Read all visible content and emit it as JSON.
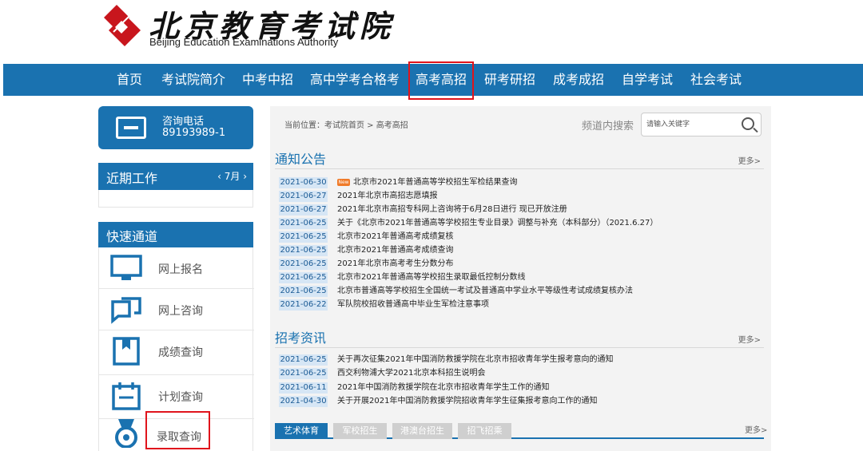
{
  "header": {
    "title_cn": "北京教育考试院",
    "title_en": "Beijing Education Examinations Authority"
  },
  "nav": {
    "items": [
      "首页",
      "考试院简介",
      "中考中招",
      "高中学考合格考",
      "高考高招",
      "研考研招",
      "成考成招",
      "自学考试",
      "社会考试"
    ],
    "active": "高考高招"
  },
  "sidebar": {
    "consult_label": "咨询电话",
    "consult_phone": "89193989-1",
    "recent_title": "近期工作",
    "recent_month": "‹ 7月 ›",
    "quick_title": "快速通道",
    "quick_items": [
      {
        "label": "网上报名",
        "icon": "monitor-icon"
      },
      {
        "label": "网上咨询",
        "icon": "chat-icon"
      },
      {
        "label": "成绩查询",
        "icon": "bookmark-icon"
      },
      {
        "label": "计划查询",
        "icon": "calendar-icon"
      },
      {
        "label": "录取查询",
        "icon": "medal-icon"
      }
    ]
  },
  "main": {
    "breadcrumb": "当前位置：考试院首页 > 高考高招",
    "search_label": "频道内搜索",
    "search_placeholder": "请输入关键字",
    "notice": {
      "title": "通知公告",
      "more": "更多>",
      "items": [
        {
          "date": "2021-06-30",
          "text": "北京市2021年普通高等学校招生军检结果查询",
          "new": true,
          "badge": "New"
        },
        {
          "date": "2021-06-27",
          "text": "2021年北京市高招志愿填报"
        },
        {
          "date": "2021-06-27",
          "text": "2021年北京市高招专科网上咨询将于6月28日进行 现已开放注册"
        },
        {
          "date": "2021-06-25",
          "text": "关于《北京市2021年普通高等学校招生专业目录》调整与补充（本科部分）（2021.6.27）"
        },
        {
          "date": "2021-06-25",
          "text": "北京市2021年普通高考成绩复核"
        },
        {
          "date": "2021-06-25",
          "text": "北京市2021年普通高考成绩查询"
        },
        {
          "date": "2021-06-25",
          "text": "2021年北京市高考考生分数分布"
        },
        {
          "date": "2021-06-25",
          "text": "北京市2021年普通高等学校招生录取最低控制分数线"
        },
        {
          "date": "2021-06-25",
          "text": "北京市普通高等学校招生全国统一考试及普通高中学业水平等级性考试成绩复核办法"
        },
        {
          "date": "2021-06-22",
          "text": "军队院校招收普通高中毕业生军检注意事项"
        }
      ]
    },
    "exam_news": {
      "title": "招考资讯",
      "more": "更多>",
      "items": [
        {
          "date": "2021-06-25",
          "text": "关于再次征集2021年中国消防救援学院在北京市招收青年学生报考意向的通知"
        },
        {
          "date": "2021-06-25",
          "text": "西交利物浦大学2021北京本科招生说明会"
        },
        {
          "date": "2021-06-11",
          "text": "2021年中国消防救援学院在北京市招收青年学生工作的通知"
        },
        {
          "date": "2021-04-30",
          "text": "关于开展2021年中国消防救援学院招收青年学生征集报考意向工作的通知"
        }
      ]
    },
    "tabs": {
      "items": [
        "艺术体育",
        "军校招生",
        "港澳台招生",
        "招飞招乘"
      ],
      "active": "艺术体育",
      "more": "更多>"
    }
  },
  "colors": {
    "brand_blue": "#1a72b0",
    "highlight_red": "#e0141c",
    "date_bg": "#d6e6f5",
    "new_badge": "#f07a28"
  }
}
